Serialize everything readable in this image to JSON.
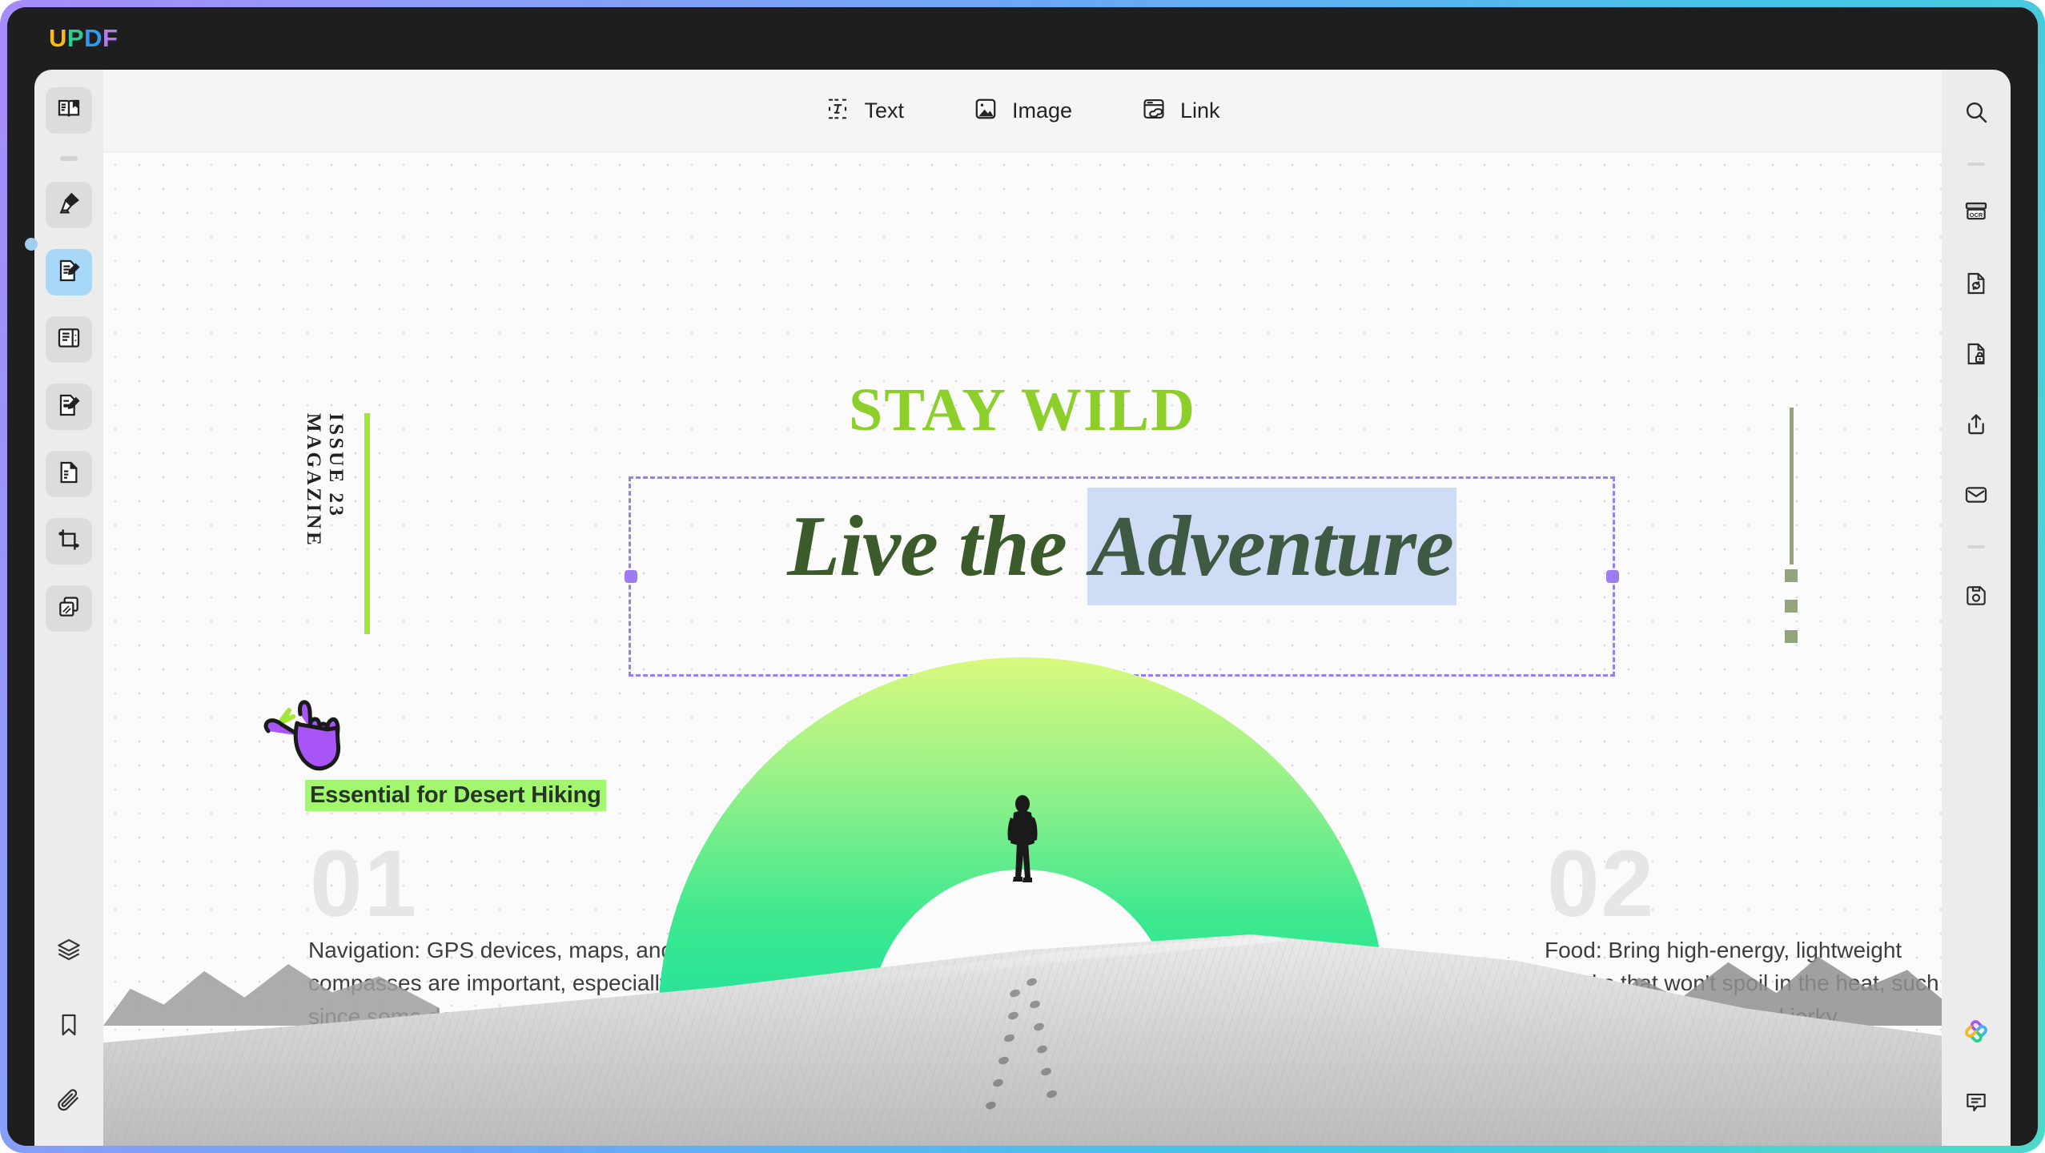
{
  "app": {
    "name_parts": [
      "U",
      "P",
      "D",
      "F"
    ]
  },
  "edit_toolbar": {
    "items": [
      {
        "label": "Text",
        "icon": "text-box-icon"
      },
      {
        "label": "Image",
        "icon": "image-icon"
      },
      {
        "label": "Link",
        "icon": "link-icon"
      }
    ]
  },
  "left_rail": {
    "top_items": [
      {
        "name": "reader-mode",
        "icon": "book-reader-icon",
        "active": false
      },
      {
        "name": "annotate",
        "icon": "highlighter-icon",
        "active": false
      },
      {
        "name": "edit-pdf",
        "icon": "edit-document-icon",
        "active": true
      },
      {
        "name": "page-layout",
        "icon": "document-panel-icon",
        "active": false
      },
      {
        "name": "fill-sign",
        "icon": "form-edit-icon",
        "active": false
      },
      {
        "name": "organize-pages",
        "icon": "page-fold-icon",
        "active": false
      },
      {
        "name": "crop-page",
        "icon": "crop-icon",
        "active": false
      },
      {
        "name": "compare",
        "icon": "compare-pages-icon",
        "active": false
      }
    ],
    "bottom_items": [
      {
        "name": "layers",
        "icon": "layers-icon"
      },
      {
        "name": "bookmarks",
        "icon": "bookmark-icon"
      },
      {
        "name": "attachments",
        "icon": "paperclip-icon"
      }
    ]
  },
  "right_rail": {
    "top_items": [
      {
        "name": "search",
        "icon": "search-icon"
      },
      {
        "name": "ocr",
        "icon": "ocr-icon"
      },
      {
        "name": "convert",
        "icon": "convert-document-icon"
      },
      {
        "name": "protect",
        "icon": "document-lock-icon"
      },
      {
        "name": "share",
        "icon": "share-upload-icon"
      },
      {
        "name": "email",
        "icon": "mail-icon"
      },
      {
        "name": "save",
        "icon": "floppy-save-icon"
      }
    ],
    "bottom_items": [
      {
        "name": "ai-assistant",
        "icon": "ai-flower-icon"
      },
      {
        "name": "comments",
        "icon": "comment-bubble-icon"
      }
    ]
  },
  "document": {
    "issue_label": "ISSUE 23 MAGAZINE",
    "kicker": "STAY WILD",
    "headline_plain": "Live the ",
    "headline_selected": "Adventure",
    "subhead": "Essential for Desert Hiking",
    "columns": [
      {
        "number": "01",
        "body": "Navigation: GPS devices, maps, and compasses are important, especially since some desert trails may not be well-marked."
      },
      {
        "number": "02",
        "body": "Food: Bring high-energy, lightweight snacks that won't spoil in the heat, such as nuts, dried fruits, and jerky."
      }
    ],
    "sticker": "rock-on-hand-sticker"
  },
  "colors": {
    "kicker_green": "#8ccf2b",
    "highlight_green": "#a3f66f",
    "script_green": "#3c5b2a",
    "selection_blue": "#cfdcf5",
    "selection_outline": "#9b7cf5",
    "sticker_purple": "#a855f7",
    "active_rail": "#a8d8f8",
    "deco_olive": "#93a37c"
  }
}
